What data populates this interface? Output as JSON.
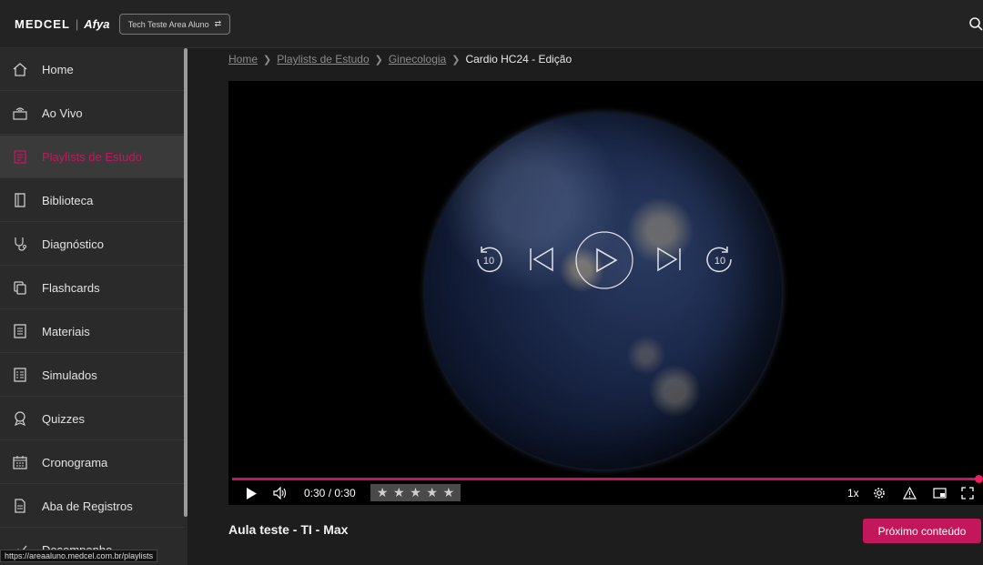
{
  "header": {
    "brand_medcel": "MEDCEL",
    "brand_sep": "|",
    "brand_afya": "Afya",
    "account_switch_label": "Tech Teste Area Aluno"
  },
  "sidebar": {
    "items": [
      {
        "label": "Home",
        "icon": "home-icon"
      },
      {
        "label": "Ao Vivo",
        "icon": "live-icon"
      },
      {
        "label": "Playlists de Estudo",
        "icon": "playlist-icon",
        "active": true
      },
      {
        "label": "Biblioteca",
        "icon": "book-icon"
      },
      {
        "label": "Diagnóstico",
        "icon": "stethoscope-icon"
      },
      {
        "label": "Flashcards",
        "icon": "cards-icon"
      },
      {
        "label": "Materiais",
        "icon": "document-icon"
      },
      {
        "label": "Simulados",
        "icon": "checklist-icon"
      },
      {
        "label": "Quizzes",
        "icon": "award-icon"
      },
      {
        "label": "Cronograma",
        "icon": "calendar-icon"
      },
      {
        "label": "Aba de Registros",
        "icon": "notes-icon"
      },
      {
        "label": "Desempenho",
        "icon": "chart-icon"
      }
    ]
  },
  "breadcrumb": {
    "items": [
      "Home",
      "Playlists de Estudo",
      "Ginecologia"
    ],
    "current": "Cardio HC24 - Edição"
  },
  "player": {
    "rewind_label": "10",
    "forward_label": "10",
    "time": "0:30 / 0:30",
    "progress_fraction": 1.0,
    "rating_stars": 5,
    "speed": "1x"
  },
  "content": {
    "title": "Aula teste - TI - Max",
    "next_button": "Próximo conteúdo"
  },
  "status_url": "https://areaaluno.medcel.com.br/playlists",
  "colors": {
    "accent": "#c2185b",
    "background": "#1d1d1d",
    "sidebar": "#2a2a2a"
  }
}
